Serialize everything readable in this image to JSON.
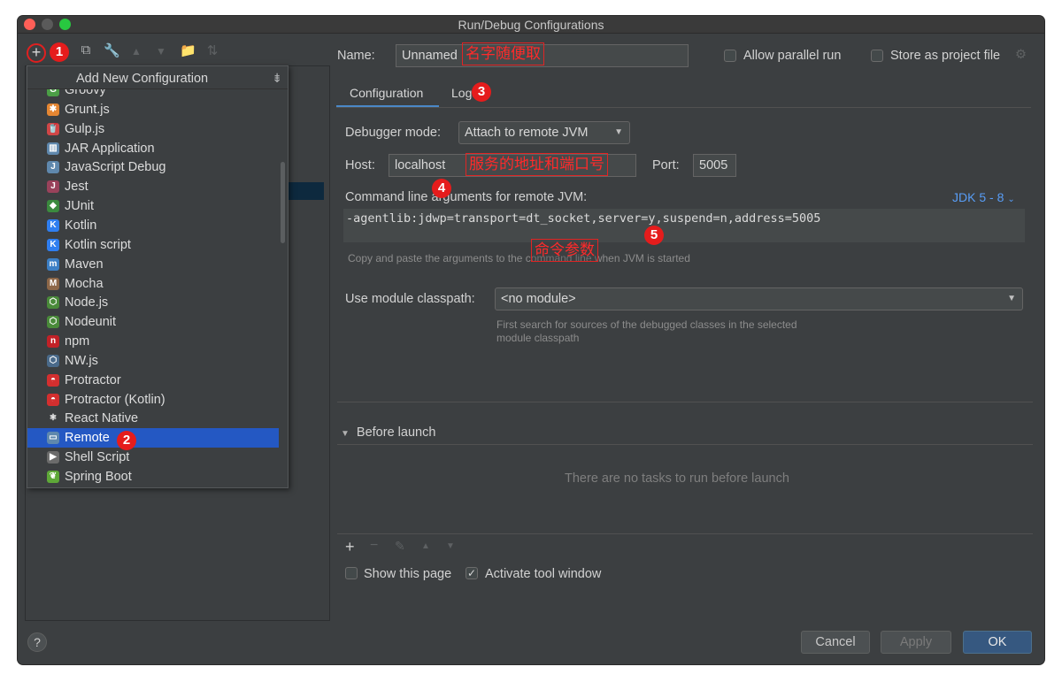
{
  "window": {
    "title": "Run/Debug Configurations"
  },
  "toolbar": {
    "add_label": "+",
    "copy_icon": "copy-icon",
    "wrench_icon": "wrench-icon",
    "move_up_icon": "arrow-up-icon",
    "move_down_icon": "arrow-down-icon",
    "folder_icon": "new-folder-icon",
    "sort_icon": "sort-icon"
  },
  "popup": {
    "title": "Add New Configuration",
    "pin_glyph": "⇟",
    "items": [
      {
        "label": "Groovy",
        "icon": "groovy-icon",
        "icon_glyph": "G",
        "icon_color": "#4b9e46"
      },
      {
        "label": "Grunt.js",
        "icon": "grunt-icon",
        "icon_glyph": "✱",
        "icon_color": "#e48632"
      },
      {
        "label": "Gulp.js",
        "icon": "gulp-icon",
        "icon_glyph": "🥤",
        "icon_color": "#cf4647"
      },
      {
        "label": "JAR Application",
        "icon": "jar-icon",
        "icon_glyph": "▥",
        "icon_color": "#5f88ad"
      },
      {
        "label": "JavaScript Debug",
        "icon": "js-debug-icon",
        "icon_glyph": "J",
        "icon_color": "#5f88ad"
      },
      {
        "label": "Jest",
        "icon": "jest-icon",
        "icon_glyph": "J",
        "icon_color": "#99425b"
      },
      {
        "label": "JUnit",
        "icon": "junit-icon",
        "icon_glyph": "◆",
        "icon_color": "#3b8a3e"
      },
      {
        "label": "Kotlin",
        "icon": "kotlin-icon",
        "icon_glyph": "K",
        "icon_color": "#2f7ef0"
      },
      {
        "label": "Kotlin script",
        "icon": "kotlin-script-icon",
        "icon_glyph": "K",
        "icon_color": "#2f7ef0"
      },
      {
        "label": "Maven",
        "icon": "maven-icon",
        "icon_glyph": "m",
        "icon_color": "#3c7fc5"
      },
      {
        "label": "Mocha",
        "icon": "mocha-icon",
        "icon_glyph": "M",
        "icon_color": "#8d6748"
      },
      {
        "label": "Node.js",
        "icon": "nodejs-icon",
        "icon_glyph": "⬡",
        "icon_color": "#4a8a3a"
      },
      {
        "label": "Nodeunit",
        "icon": "nodeunit-icon",
        "icon_glyph": "⬡",
        "icon_color": "#4a8a3a"
      },
      {
        "label": "npm",
        "icon": "npm-icon",
        "icon_glyph": "n",
        "icon_color": "#c12127"
      },
      {
        "label": "NW.js",
        "icon": "nwjs-icon",
        "icon_glyph": "⬡",
        "icon_color": "#4a6a8a"
      },
      {
        "label": "Protractor",
        "icon": "protractor-icon",
        "icon_glyph": "◓",
        "icon_color": "#d32f2f"
      },
      {
        "label": "Protractor (Kotlin)",
        "icon": "protractor-kotlin-icon",
        "icon_glyph": "◓",
        "icon_color": "#d32f2f"
      },
      {
        "label": "React Native",
        "icon": "react-native-icon",
        "icon_glyph": "⚛",
        "icon_color": "#3c3f41"
      },
      {
        "label": "Remote",
        "icon": "remote-icon",
        "icon_glyph": "▭",
        "icon_color": "#5f88ad"
      },
      {
        "label": "Shell Script",
        "icon": "shell-script-icon",
        "icon_glyph": "▶",
        "icon_color": "#6b6b6b"
      },
      {
        "label": "Spring Boot",
        "icon": "spring-boot-icon",
        "icon_glyph": "❦",
        "icon_color": "#5ea838"
      }
    ],
    "selected_index": 18
  },
  "config": {
    "name_label": "Name:",
    "name_value": "Unnamed",
    "allow_parallel_label": "Allow parallel run",
    "store_project_label": "Store as project file",
    "tabs": [
      {
        "label": "Configuration"
      },
      {
        "label": "Logs"
      }
    ],
    "debugger_mode_label": "Debugger mode:",
    "debugger_mode_value": "Attach to remote JVM",
    "host_label": "Host:",
    "host_value": "localhost",
    "port_label": "Port:",
    "port_value": "5005",
    "cmd_label": "Command line arguments for remote JVM:",
    "jdk_link": "JDK 5 - 8",
    "cmd_value": "-agentlib:jdwp=transport=dt_socket,server=y,suspend=n,address=5005",
    "cmd_hint": "Copy and paste the arguments to the command line when JVM is started",
    "module_label": "Use module classpath:",
    "module_value": "<no module>",
    "module_hint_1": "First search for sources of the debugged classes in the selected",
    "module_hint_2": "module classpath",
    "before_launch_label": "Before launch",
    "no_tasks_text": "There are no tasks to run before launch",
    "show_page_label": "Show this page",
    "activate_tool_label": "Activate tool window",
    "activate_tool_checked": true,
    "show_page_checked": false
  },
  "annotations": {
    "a1": "1",
    "a2": "2",
    "a3": "3",
    "a4": "4",
    "a5": "5",
    "name_note": "名字随便取",
    "host_note": "服务的地址和端口号",
    "cmd_note": "命令参数",
    "note_color": "#e02424"
  },
  "buttons": {
    "cancel": "Cancel",
    "apply": "Apply",
    "ok": "OK",
    "help": "?"
  },
  "lower_toolbar": {
    "add": "+",
    "remove": "−",
    "edit": "✎",
    "up": "▲",
    "down": "▼"
  }
}
